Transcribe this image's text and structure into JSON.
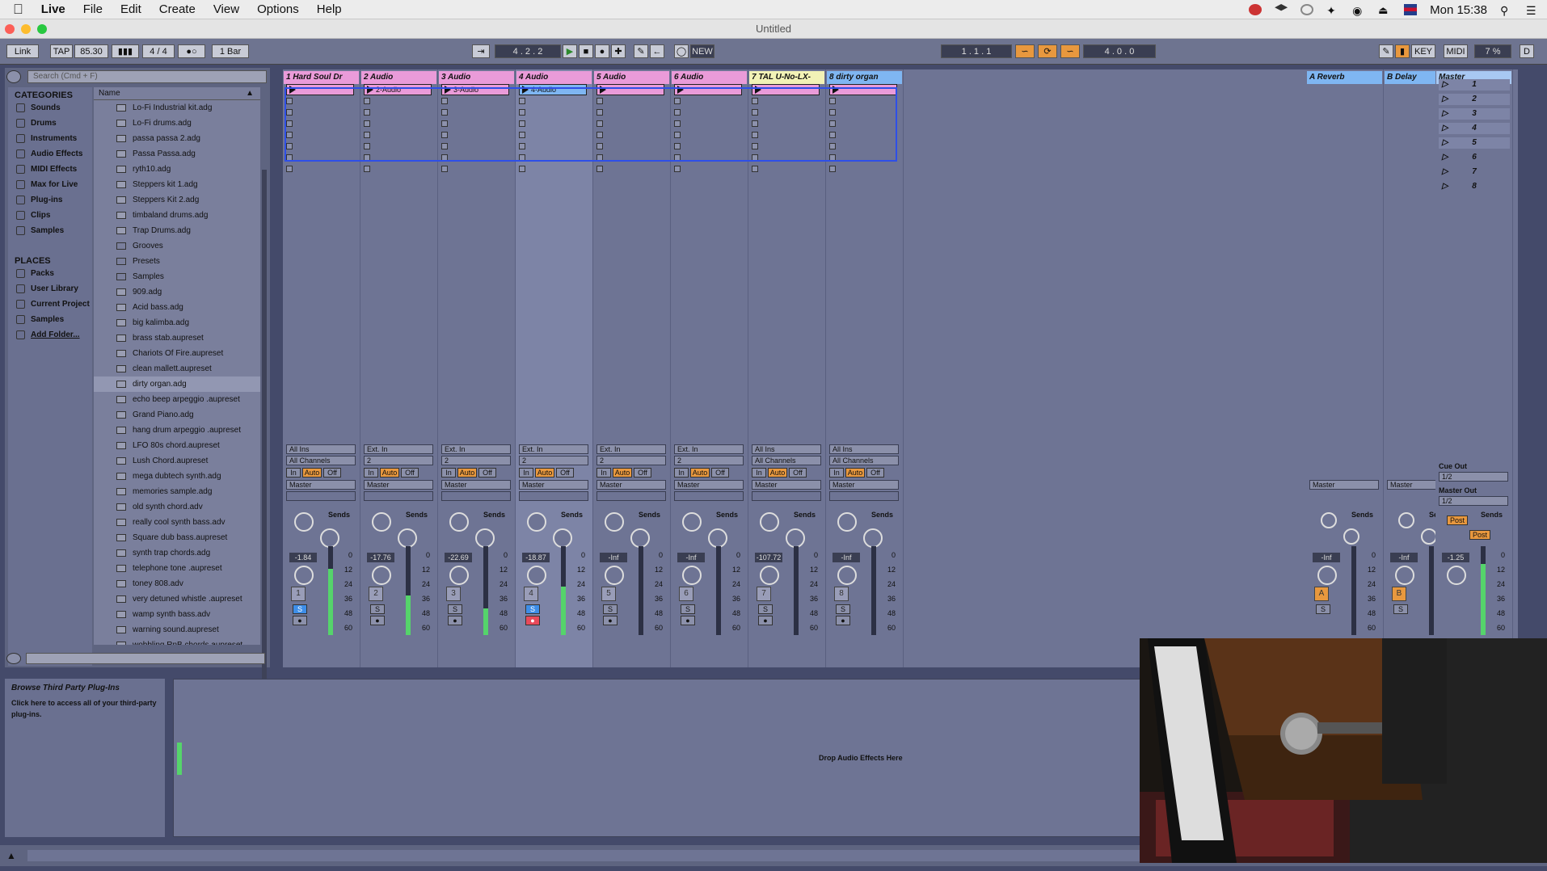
{
  "menubar": {
    "app": "Live",
    "items": [
      "File",
      "Edit",
      "Create",
      "View",
      "Options",
      "Help"
    ],
    "clock": "Mon 15:38"
  },
  "window": {
    "title": "Untitled"
  },
  "transport": {
    "link": "Link",
    "tap": "TAP",
    "tempo": "85.30",
    "signature": "4 / 4",
    "quant": "1 Bar",
    "position": "4 . 2 . 2",
    "new_label": "NEW",
    "loop_start": "1 . 1 . 1",
    "loop_len": "4 . 0 . 0",
    "key": "KEY",
    "midi": "MIDI",
    "cpu": "7 %",
    "d": "D"
  },
  "browser": {
    "search_placeholder": "Search (Cmd + F)",
    "categories_title": "CATEGORIES",
    "categories": [
      "Sounds",
      "Drums",
      "Instruments",
      "Audio Effects",
      "MIDI Effects",
      "Max for Live",
      "Plug-ins",
      "Clips",
      "Samples"
    ],
    "places_title": "PLACES",
    "places": [
      "Packs",
      "User Library",
      "Current Project",
      "Samples",
      "Add Folder..."
    ],
    "name_header": "Name",
    "files": [
      "Lo-Fi Industrial kit.adg",
      "Lo-Fi drums.adg",
      "passa passa 2.adg",
      "Passa Passa.adg",
      "ryth10.adg",
      "Steppers kit 1.adg",
      "Steppers Kit 2.adg",
      "timbaland drums.adg",
      "Trap  Drums.adg",
      "Grooves",
      "Presets",
      "Samples",
      "909.adg",
      "Acid bass.adg",
      "big kalimba.adg",
      "brass stab.aupreset",
      "Chariots Of Fire.aupreset",
      "clean mallett.aupreset",
      "dirty organ.adg",
      "echo beep arpeggio .aupreset",
      "Grand Piano.adg",
      "hang drum arpeggio .aupreset",
      "LFO 80s chord.aupreset",
      "Lush Chord.aupreset",
      "mega dubtech synth.adg",
      "memories sample.adg",
      "old synth chord.adv",
      "really cool synth bass.adv",
      "Square dub bass.aupreset",
      "synth trap chords.adg",
      "telephone tone .aupreset",
      "toney 808.adv",
      "very detuned whistle .aupreset",
      "wamp synth bass.adv",
      "warning  sound.aupreset",
      "wobbling RnB chords.aupreset"
    ]
  },
  "tracks": [
    {
      "name": "1 Hard Soul Dr",
      "clip": "",
      "in1": "All Ins",
      "in2": "All Channels",
      "vol": "-1.84",
      "num": "1",
      "color": "#ea9bd9"
    },
    {
      "name": "2 Audio",
      "clip": "2-Audio",
      "in1": "Ext. In",
      "in2": "2",
      "vol": "-17.76",
      "num": "2",
      "color": "#ea9bd9"
    },
    {
      "name": "3 Audio",
      "clip": "3-Audio",
      "in1": "Ext. In",
      "in2": "2",
      "vol": "-22.69",
      "num": "3",
      "color": "#ea9bd9"
    },
    {
      "name": "4 Audio",
      "clip": "4-Audio",
      "in1": "Ext. In",
      "in2": "2",
      "vol": "-18.87",
      "num": "4",
      "color": "#ea9bd9"
    },
    {
      "name": "5 Audio",
      "clip": "",
      "in1": "Ext. In",
      "in2": "2",
      "vol": "-Inf",
      "num": "5",
      "color": "#ea9bd9"
    },
    {
      "name": "6 Audio",
      "clip": "",
      "in1": "Ext. In",
      "in2": "2",
      "vol": "-Inf",
      "num": "6",
      "color": "#ea9bd9"
    },
    {
      "name": "7 TAL U-No-LX-",
      "clip": "",
      "in1": "All Ins",
      "in2": "All Channels",
      "vol": "-107.72",
      "num": "7",
      "color": "#f2f2b6"
    },
    {
      "name": "8 dirty organ",
      "clip": "",
      "in1": "All Ins",
      "in2": "All Channels",
      "vol": "-Inf",
      "num": "8",
      "color": "#7fb6f2"
    }
  ],
  "returns": [
    {
      "name": "A Reverb",
      "vol": "-Inf",
      "letter": "A"
    },
    {
      "name": "B Delay",
      "vol": "-Inf",
      "letter": "B"
    }
  ],
  "master": {
    "name": "Master",
    "vol": "-1.25",
    "scenes": [
      "1",
      "2",
      "3",
      "4",
      "5",
      "6",
      "7",
      "8"
    ],
    "cue_out": "Cue Out",
    "cue_val": "1/2",
    "master_out": "Master Out",
    "master_val": "1/2",
    "post": "Post"
  },
  "mixer_labels": {
    "in": "In",
    "auto": "Auto",
    "off": "Off",
    "master": "Master",
    "sends": "Sends",
    "a": "A",
    "b": "B",
    "s": "S",
    "db": [
      "0",
      "12",
      "24",
      "36",
      "48",
      "60"
    ]
  },
  "info": {
    "title": "Browse Third Party Plug-Ins",
    "text": "Click here to access all of your third-party plug-ins."
  },
  "device": {
    "drop": "Drop Audio Effects Here"
  }
}
